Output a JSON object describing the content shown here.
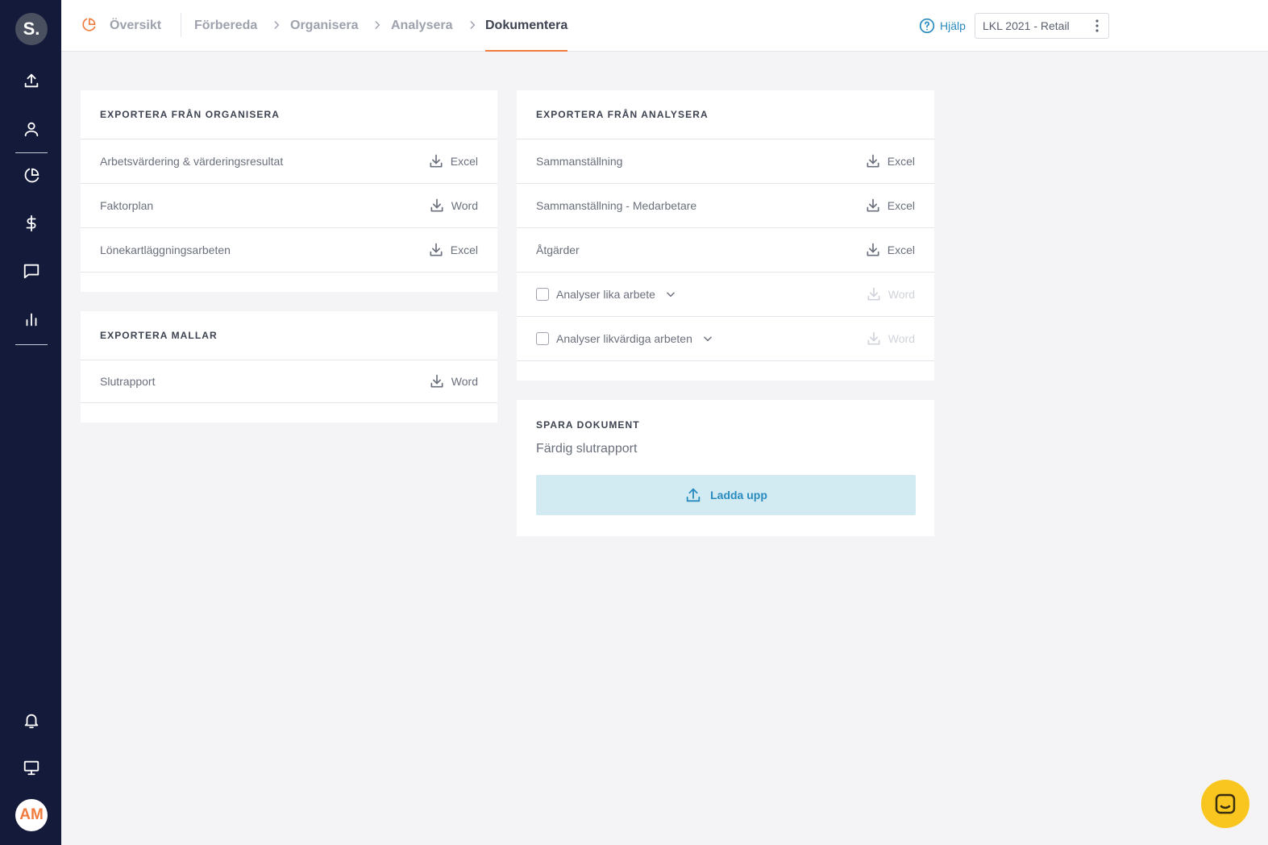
{
  "sidebar": {
    "logo": "S.",
    "icons": [
      "upload-icon",
      "user-icon",
      "pie-chart-icon",
      "dollar-icon",
      "message-icon",
      "bar-chart-icon",
      "bell-icon",
      "monitor-icon"
    ],
    "avatar": "AM"
  },
  "topbar": {
    "overview": "Översikt",
    "steps": [
      "Förbereda",
      "Organisera",
      "Analysera",
      "Dokumentera"
    ],
    "active_step": "Dokumentera",
    "help": "Hjälp",
    "project": "LKL 2021 - Retail"
  },
  "export_organisera": {
    "title": "EXPORTERA FRÅN ORGANISERA",
    "rows": [
      {
        "label": "Arbetsvärdering & värderingsresultat",
        "format": "Excel"
      },
      {
        "label": "Faktorplan",
        "format": "Word"
      },
      {
        "label": "Lönekartläggningsarbeten",
        "format": "Excel"
      }
    ]
  },
  "export_mallar": {
    "title": "EXPORTERA MALLAR",
    "rows": [
      {
        "label": "Slutrapport",
        "format": "Word"
      }
    ]
  },
  "export_analysera": {
    "title": "EXPORTERA FRÅN ANALYSERA",
    "rows": [
      {
        "label": "Sammanställning",
        "format": "Excel"
      },
      {
        "label": "Sammanställning - Medarbetare",
        "format": "Excel"
      },
      {
        "label": "Åtgärder",
        "format": "Excel"
      }
    ],
    "checkbox_rows": [
      {
        "label": "Analyser lika arbete",
        "format": "Word"
      },
      {
        "label": "Analyser likvärdiga arbeten",
        "format": "Word"
      }
    ]
  },
  "save_document": {
    "title": "SPARA DOKUMENT",
    "subtitle": "Färdig slutrapport",
    "upload_label": "Ladda upp"
  },
  "colors": {
    "sidebar": "#141a3a",
    "accent": "#f07b3f",
    "link": "#2a8bbf",
    "upload_bg": "#d2eaf2",
    "chat": "#f9c620"
  }
}
